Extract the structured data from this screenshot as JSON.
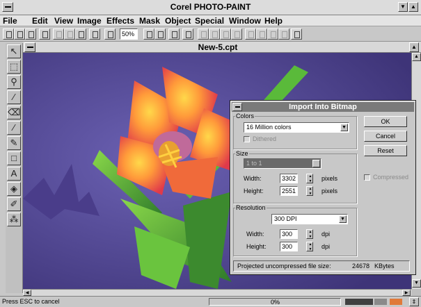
{
  "app": {
    "title": "Corel PHOTO-PAINT"
  },
  "menu": [
    "File",
    "Edit",
    "View",
    "Image",
    "Effects",
    "Mask",
    "Object",
    "Special",
    "Window",
    "Help"
  ],
  "toolbar": {
    "zoom": "50%"
  },
  "document": {
    "title": "New-5.cpt"
  },
  "dialog": {
    "title": "Import Into Bitmap",
    "colors_label": "Colors",
    "colors_value": "16 Million colors",
    "dithered_label": "Dithered",
    "size_label": "Size",
    "size_value": "1 to 1",
    "width_label": "Width:",
    "width_value": "3302",
    "height_label": "Height:",
    "height_value": "2551",
    "size_unit": "pixels",
    "resolution_label": "Resolution",
    "resolution_value": "300 DPI",
    "res_width_label": "Width:",
    "res_width_value": "300",
    "res_height_label": "Height:",
    "res_height_value": "300",
    "res_unit": "dpi",
    "projected_label": "Projected uncompressed file size:",
    "projected_value": "24678",
    "projected_unit": "KBytes",
    "ok": "OK",
    "cancel": "Cancel",
    "reset": "Reset",
    "compressed_label": "Compressed"
  },
  "status": {
    "message": "Press ESC to cancel",
    "progress": "0%"
  },
  "colors": {
    "canvas_bg": "#5b4f9a",
    "dialog_title": "#7a7a7a"
  }
}
